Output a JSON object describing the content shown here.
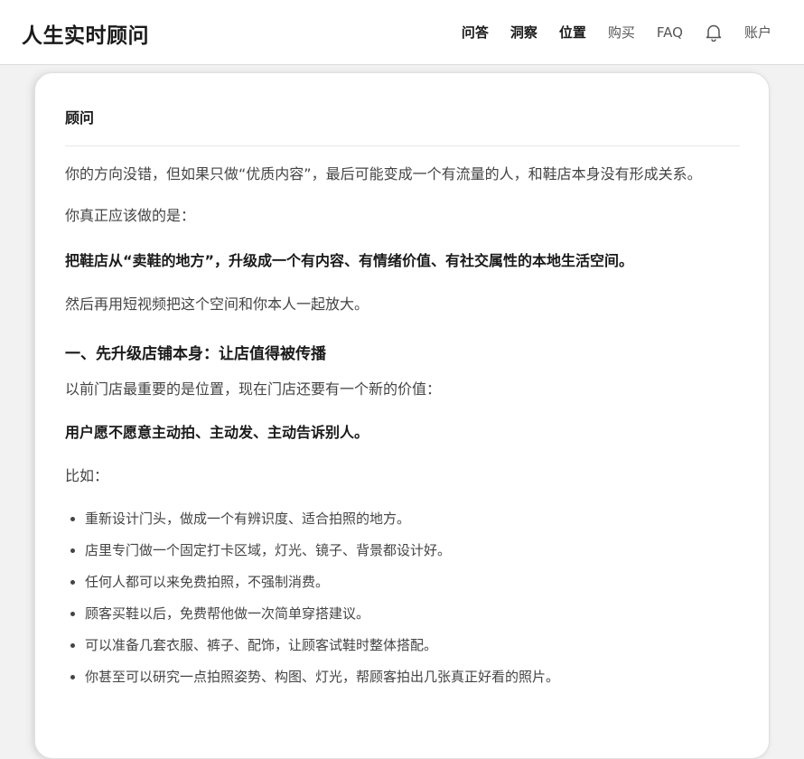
{
  "header": {
    "brand": "人生实时顾问",
    "nav": [
      {
        "label": "问答"
      },
      {
        "label": "洞察"
      },
      {
        "label": "位置"
      },
      {
        "label": "购买"
      },
      {
        "label": "FAQ"
      },
      {
        "label": "账户"
      }
    ],
    "bell_icon": "bell-icon"
  },
  "card": {
    "title": "顾问",
    "paragraph1": "你的方向没错，但如果只做“优质内容”，最后可能变成一个有流量的人，和鞋店本身没有形成关系。",
    "paragraph2": "你真正应该做的是：",
    "paragraph3": "把鞋店从“卖鞋的地方”，升级成一个有内容、有情绪价值、有社交属性的本地生活空间。",
    "paragraph4": "然后再用短视频把这个空间和你本人一起放大。",
    "section1_title": "一、先升级店铺本身：让店值得被传播",
    "paragraph5": "以前门店最重要的是位置，现在门店还要有一个新的价值：",
    "paragraph6": "用户愿不愿意主动拍、主动发、主动告诉别人。",
    "paragraph7": "比如：",
    "list": [
      "重新设计门头，做成一个有辨识度、适合拍照的地方。",
      "店里专门做一个固定打卡区域，灯光、镜子、背景都设计好。",
      "任何人都可以来免费拍照，不强制消费。",
      "顾客买鞋以后，免费帮他做一次简单穿搭建议。",
      "可以准备几套衣服、裤子、配饰，让顾客试鞋时整体搭配。",
      "你甚至可以研究一点拍照姿势、构图、灯光，帮顾客拍出几张真正好看的照片。"
    ]
  },
  "colors": {
    "background": "#f2f2f2",
    "card": "#ffffff",
    "text_primary": "#1a1a1a",
    "text_body": "#444444"
  }
}
